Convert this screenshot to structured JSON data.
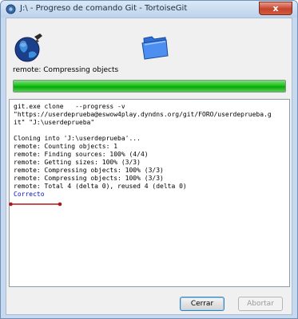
{
  "window": {
    "title": "J:\\ - Progreso de comando Git - TortoiseGit",
    "close_label": "x"
  },
  "icons": {
    "left": "globe-icon",
    "right": "folder-icon"
  },
  "status": "remote: Compressing objects",
  "progress": {
    "percent": 100,
    "color": "#1ec21e"
  },
  "log": [
    {
      "text": "git.exe clone   --progress -v",
      "kind": "normal"
    },
    {
      "text": "\"https://userdeprueba@eswow4play.dyndns.org/git/FORO/userdeprueba.g",
      "kind": "normal"
    },
    {
      "text": "it\" \"J:\\userdeprueba\"",
      "kind": "normal"
    },
    {
      "text": "",
      "kind": "blank"
    },
    {
      "text": "Cloning into 'J:\\userdeprueba'...",
      "kind": "normal"
    },
    {
      "text": "remote: Counting objects: 1",
      "kind": "normal"
    },
    {
      "text": "remote: Finding sources: 100% (4/4)",
      "kind": "normal"
    },
    {
      "text": "remote: Getting sizes: 100% (3/3)",
      "kind": "normal"
    },
    {
      "text": "remote: Compressing objects: 100% (3/3)",
      "kind": "normal"
    },
    {
      "text": "remote: Compressing objects: 100% (3/3)",
      "kind": "normal"
    },
    {
      "text": "remote: Total 4 (delta 0), reused 4 (delta 0)",
      "kind": "normal"
    },
    {
      "text": "Correcto",
      "kind": "ok"
    }
  ],
  "buttons": {
    "close": "Cerrar",
    "abort": "Abortar"
  }
}
